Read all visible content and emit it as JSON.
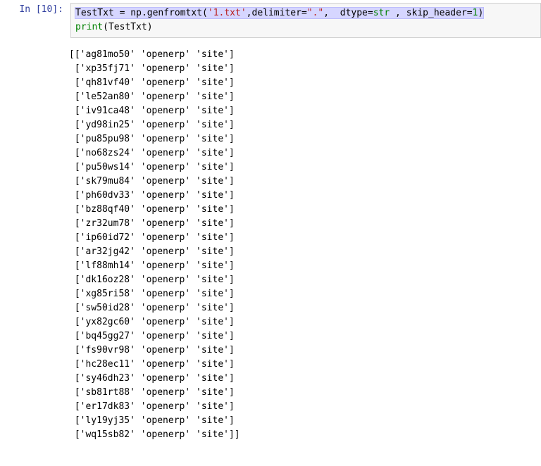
{
  "cell": {
    "prompt_label": "In [10]:",
    "code_tokens": {
      "var": "TestTxt",
      "eq": " = ",
      "np": "np",
      "dot": ".",
      "genfromtxt": "genfromtxt",
      "p_open": "(",
      "file_str": "'1.txt'",
      "comma1": ",",
      "delimiter_kw": "delimiter",
      "eq2": "=",
      "delim_str": "\".\"",
      "comma2": ",  ",
      "dtype_kw": "dtype",
      "eq3": "=",
      "str_tok": "str",
      "sp": " ",
      "comma3": ",",
      "sp2": " ",
      "skip_kw": "skip_header",
      "eq4": "=",
      "one": "1",
      "p_close": ")",
      "print_kw": "print",
      "p2_open": "(",
      "arg": "TestTxt",
      "p2_close": ")"
    }
  },
  "output": {
    "rows": [
      {
        "open": "[[",
        "a": "'ag81mo50'",
        "b": "'openerp'",
        "c": "'site'",
        "close": "]"
      },
      {
        "open": " [",
        "a": "'xp35fj71'",
        "b": "'openerp'",
        "c": "'site'",
        "close": "]"
      },
      {
        "open": " [",
        "a": "'qh81vf40'",
        "b": "'openerp'",
        "c": "'site'",
        "close": "]"
      },
      {
        "open": " [",
        "a": "'le52an80'",
        "b": "'openerp'",
        "c": "'site'",
        "close": "]"
      },
      {
        "open": " [",
        "a": "'iv91ca48'",
        "b": "'openerp'",
        "c": "'site'",
        "close": "]"
      },
      {
        "open": " [",
        "a": "'yd98in25'",
        "b": "'openerp'",
        "c": "'site'",
        "close": "]"
      },
      {
        "open": " [",
        "a": "'pu85pu98'",
        "b": "'openerp'",
        "c": "'site'",
        "close": "]"
      },
      {
        "open": " [",
        "a": "'no68zs24'",
        "b": "'openerp'",
        "c": "'site'",
        "close": "]"
      },
      {
        "open": " [",
        "a": "'pu50ws14'",
        "b": "'openerp'",
        "c": "'site'",
        "close": "]"
      },
      {
        "open": " [",
        "a": "'sk79mu84'",
        "b": "'openerp'",
        "c": "'site'",
        "close": "]"
      },
      {
        "open": " [",
        "a": "'ph60dv33'",
        "b": "'openerp'",
        "c": "'site'",
        "close": "]"
      },
      {
        "open": " [",
        "a": "'bz88qf40'",
        "b": "'openerp'",
        "c": "'site'",
        "close": "]"
      },
      {
        "open": " [",
        "a": "'zr32um78'",
        "b": "'openerp'",
        "c": "'site'",
        "close": "]"
      },
      {
        "open": " [",
        "a": "'ip60id72'",
        "b": "'openerp'",
        "c": "'site'",
        "close": "]"
      },
      {
        "open": " [",
        "a": "'ar32jg42'",
        "b": "'openerp'",
        "c": "'site'",
        "close": "]"
      },
      {
        "open": " [",
        "a": "'lf88mh14'",
        "b": "'openerp'",
        "c": "'site'",
        "close": "]"
      },
      {
        "open": " [",
        "a": "'dk16oz28'",
        "b": "'openerp'",
        "c": "'site'",
        "close": "]"
      },
      {
        "open": " [",
        "a": "'xg85ri58'",
        "b": "'openerp'",
        "c": "'site'",
        "close": "]"
      },
      {
        "open": " [",
        "a": "'sw50id28'",
        "b": "'openerp'",
        "c": "'site'",
        "close": "]"
      },
      {
        "open": " [",
        "a": "'yx82gc60'",
        "b": "'openerp'",
        "c": "'site'",
        "close": "]"
      },
      {
        "open": " [",
        "a": "'bq45gg27'",
        "b": "'openerp'",
        "c": "'site'",
        "close": "]"
      },
      {
        "open": " [",
        "a": "'fs90vr98'",
        "b": "'openerp'",
        "c": "'site'",
        "close": "]"
      },
      {
        "open": " [",
        "a": "'hc28ec11'",
        "b": "'openerp'",
        "c": "'site'",
        "close": "]"
      },
      {
        "open": " [",
        "a": "'sy46dh23'",
        "b": "'openerp'",
        "c": "'site'",
        "close": "]"
      },
      {
        "open": " [",
        "a": "'sb81rt88'",
        "b": "'openerp'",
        "c": "'site'",
        "close": "]"
      },
      {
        "open": " [",
        "a": "'er17dk83'",
        "b": "'openerp'",
        "c": "'site'",
        "close": "]"
      },
      {
        "open": " [",
        "a": "'ly19yj35'",
        "b": "'openerp'",
        "c": "'site'",
        "close": "]"
      },
      {
        "open": " [",
        "a": "'wq15sb82'",
        "b": "'openerp'",
        "c": "'site'",
        "close": "]]"
      }
    ]
  }
}
